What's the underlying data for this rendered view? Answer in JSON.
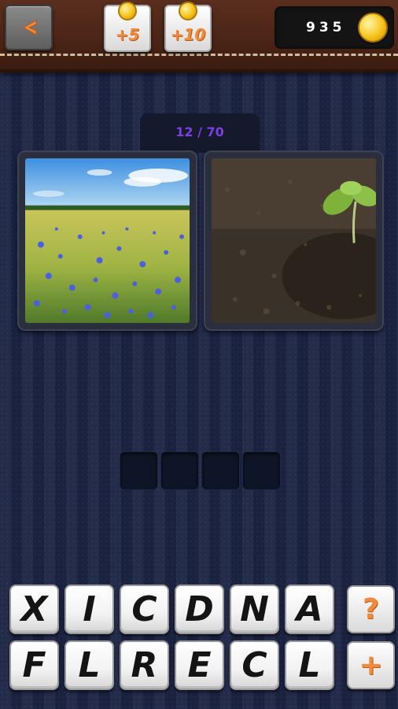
{
  "header": {
    "bonus_buttons": [
      {
        "label": "+5"
      },
      {
        "label": "+10"
      }
    ],
    "coins": "935"
  },
  "level": {
    "progress": "12 / 70"
  },
  "photos": [
    {
      "subject": "cornflower meadow"
    },
    {
      "subject": "seedling in soil"
    }
  ],
  "answer": {
    "slots": [
      "",
      "",
      "",
      ""
    ]
  },
  "letters": {
    "row1": [
      "X",
      "I",
      "C",
      "D",
      "N",
      "A"
    ],
    "row2": [
      "F",
      "L",
      "R",
      "E",
      "C",
      "L"
    ]
  },
  "side_buttons": {
    "hint_label": "?",
    "add_label": "+"
  },
  "colors": {
    "accent_orange": "#f08a3c",
    "level_purple": "#7b3fe0",
    "background_navy": "#1c2444",
    "leather_brown": "#4a2416"
  }
}
